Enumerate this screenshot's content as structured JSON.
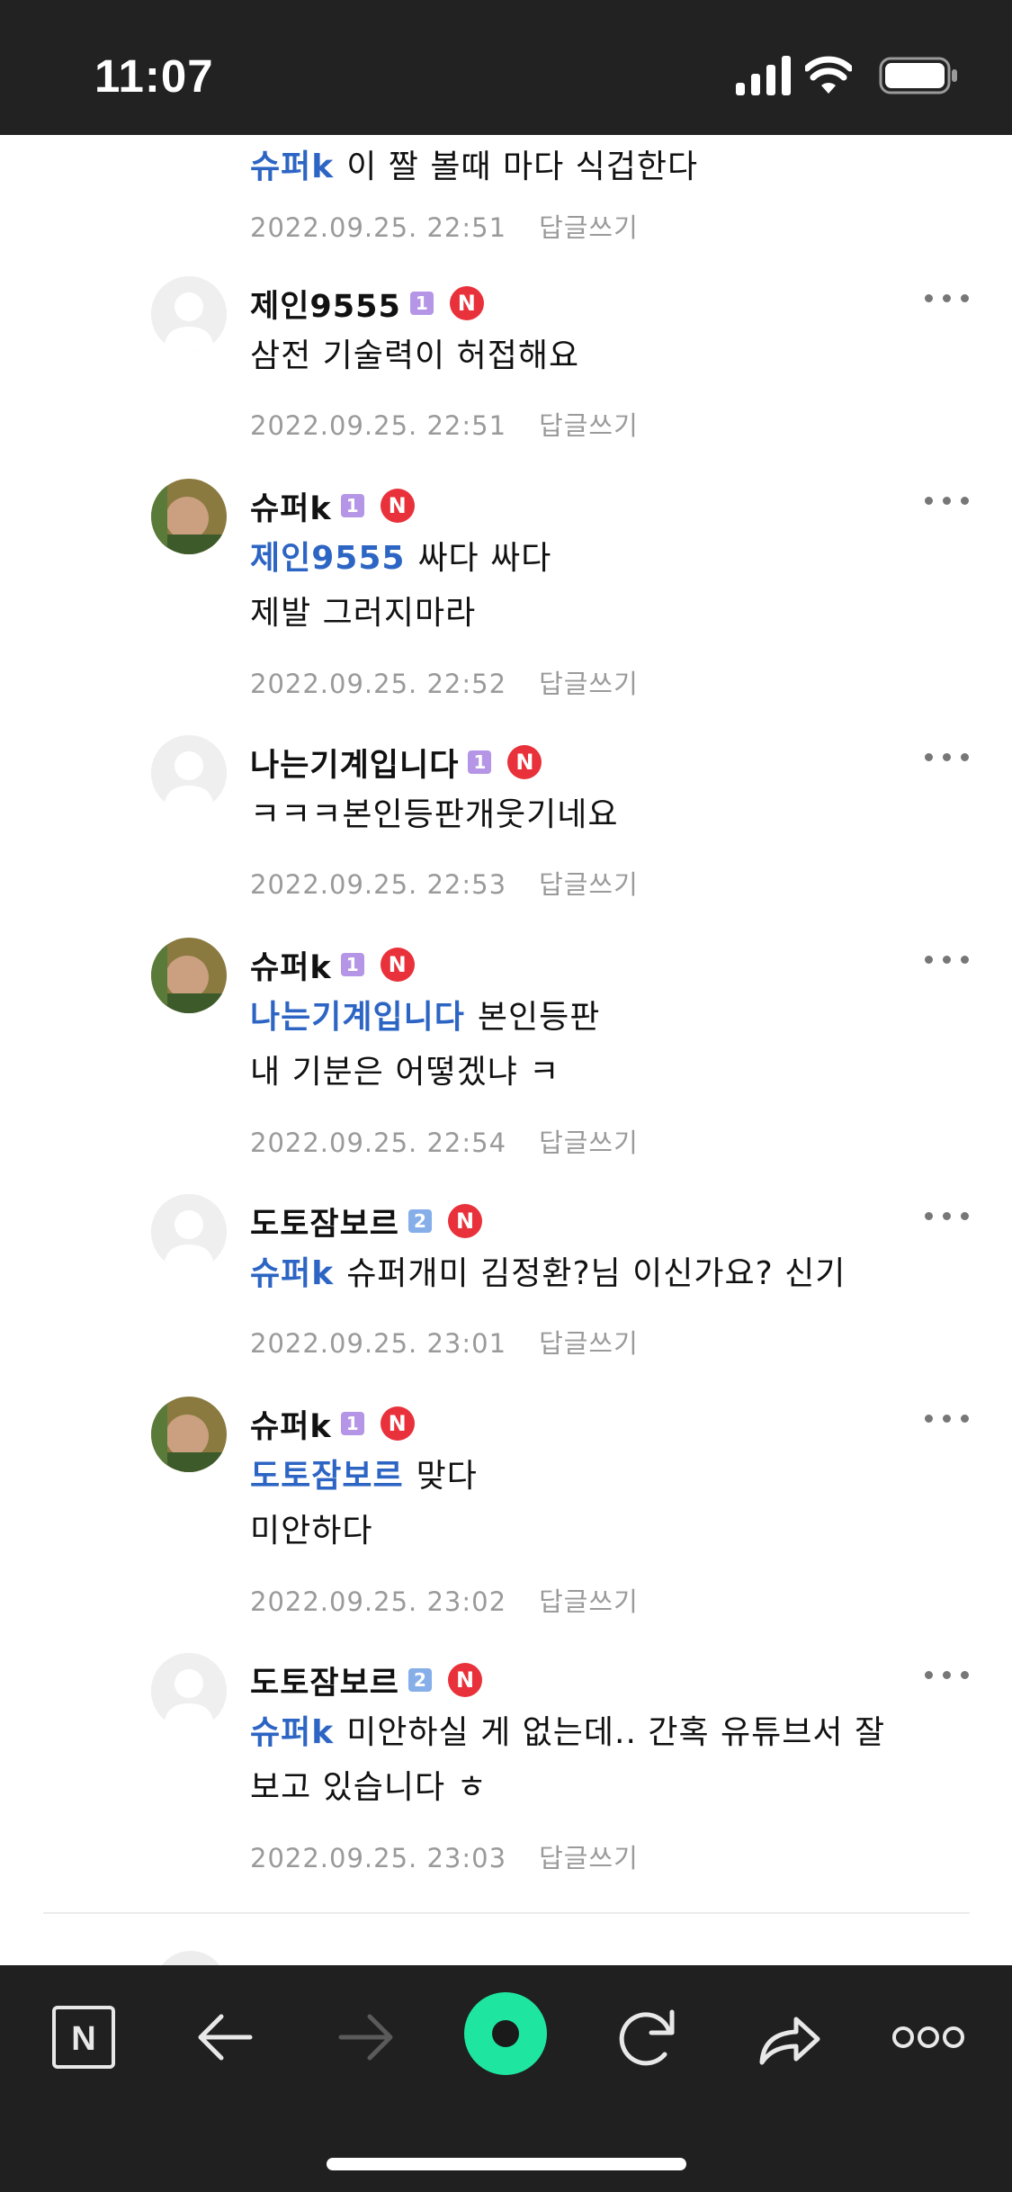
{
  "status_bar": {
    "time": "11:07"
  },
  "comments": [
    {
      "nickname": "",
      "mention": "슈퍼k",
      "lines": [
        "이 짤 볼때 마다 식겁한다"
      ],
      "date": "2022.09.25. 22:51",
      "reply": "답글쓰기",
      "avatar": "photo"
    },
    {
      "nickname": "제인9555",
      "level": "1",
      "new_badge": "N",
      "lines": [
        "삼전 기술력이 허접해요"
      ],
      "date": "2022.09.25. 22:51",
      "reply": "답글쓰기",
      "avatar": "default"
    },
    {
      "nickname": "슈퍼k",
      "level": "1",
      "new_badge": "N",
      "mention": "제인9555",
      "lines": [
        "싸다 싸다",
        "제발 그러지마라"
      ],
      "date": "2022.09.25. 22:52",
      "reply": "답글쓰기",
      "avatar": "photo"
    },
    {
      "nickname": "나는기계입니다",
      "level": "1",
      "new_badge": "N",
      "lines": [
        "ㅋㅋㅋ본인등판개웃기네요"
      ],
      "date": "2022.09.25. 22:53",
      "reply": "답글쓰기",
      "avatar": "default"
    },
    {
      "nickname": "슈퍼k",
      "level": "1",
      "new_badge": "N",
      "mention": "나는기계입니다",
      "lines": [
        "본인등판",
        "내 기분은 어떻겠냐 ㅋ"
      ],
      "date": "2022.09.25. 22:54",
      "reply": "답글쓰기",
      "avatar": "photo"
    },
    {
      "nickname": "도토잠보르",
      "level": "2",
      "new_badge": "N",
      "mention": "슈퍼k",
      "lines": [
        "슈퍼개미 김정환?님 이신가요? 신기"
      ],
      "date": "2022.09.25. 23:01",
      "reply": "답글쓰기",
      "avatar": "default"
    },
    {
      "nickname": "슈퍼k",
      "level": "1",
      "new_badge": "N",
      "mention": "도토잠보르",
      "lines": [
        "맞다",
        "미안하다"
      ],
      "date": "2022.09.25. 23:02",
      "reply": "답글쓰기",
      "avatar": "photo"
    },
    {
      "nickname": "도토잠보르",
      "level": "2",
      "new_badge": "N",
      "mention": "슈퍼k",
      "lines": [
        "미안하실 게 없는데.. 간혹 유튜브서 잘",
        "보고 있습니다 ㅎ"
      ],
      "date": "2022.09.25. 23:03",
      "reply": "답글쓰기",
      "avatar": "default"
    }
  ],
  "toolbar": {
    "items": [
      "naver-home-icon",
      "back-arrow-icon",
      "forward-arrow-icon",
      "green-dot-icon",
      "refresh-icon",
      "share-icon",
      "more-icon"
    ],
    "home_label": "N",
    "accent": "#1ee6a0"
  }
}
